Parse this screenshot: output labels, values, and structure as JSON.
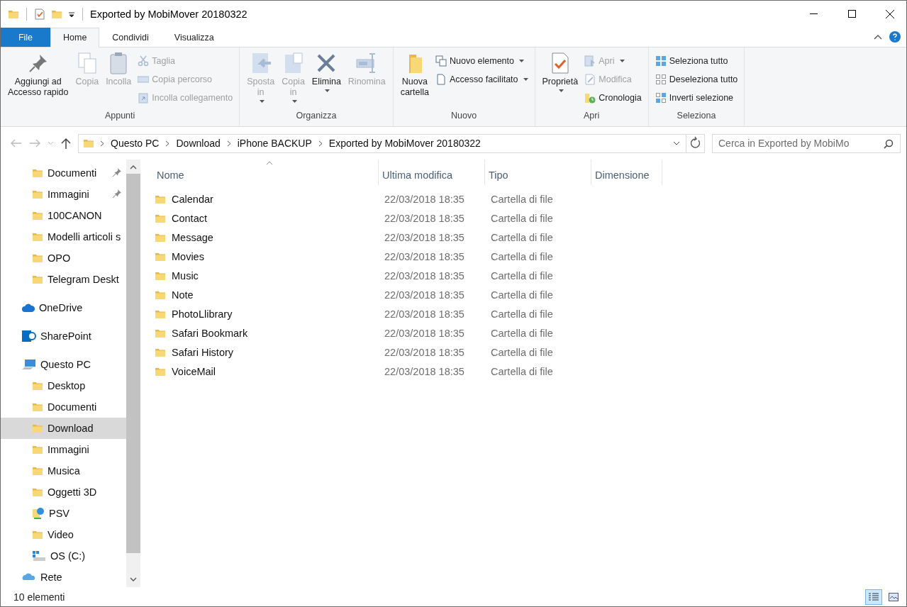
{
  "window": {
    "title": "Exported by MobiMover 20180322"
  },
  "tabs": [
    {
      "label": "File",
      "kind": "file",
      "selected": false
    },
    {
      "label": "Home",
      "kind": "tab",
      "selected": true
    },
    {
      "label": "Condividi",
      "kind": "tab",
      "selected": false
    },
    {
      "label": "Visualizza",
      "kind": "tab",
      "selected": false
    }
  ],
  "ribbon": {
    "groups": [
      {
        "label": "Appunti",
        "large": [
          {
            "label": "Aggiungi ad\nAccesso rapido",
            "disabled": false
          },
          {
            "label": "Copia",
            "disabled": true
          },
          {
            "label": "Incolla",
            "disabled": true
          }
        ],
        "small": [
          {
            "label": "Taglia",
            "disabled": true
          },
          {
            "label": "Copia percorso",
            "disabled": true
          },
          {
            "label": "Incolla collegamento",
            "disabled": true
          }
        ]
      },
      {
        "label": "Organizza",
        "large": [
          {
            "label": "Sposta\nin",
            "disabled": true,
            "dropdown": true
          },
          {
            "label": "Copia\nin",
            "disabled": true,
            "dropdown": true
          },
          {
            "label": "Elimina",
            "disabled": false,
            "dropdown": true
          },
          {
            "label": "Rinomina",
            "disabled": true,
            "dropdown": false
          }
        ]
      },
      {
        "label": "Nuovo",
        "large": [
          {
            "label": "Nuova\ncartella",
            "disabled": false
          }
        ],
        "small": [
          {
            "label": "Nuovo elemento",
            "disabled": false,
            "dropdown": true
          },
          {
            "label": "Accesso facilitato",
            "disabled": false,
            "dropdown": true
          }
        ]
      },
      {
        "label": "Apri",
        "large": [
          {
            "label": "Proprietà",
            "disabled": false,
            "dropdown": true
          }
        ],
        "small": [
          {
            "label": "Apri",
            "disabled": true,
            "dropdown": true
          },
          {
            "label": "Modifica",
            "disabled": true,
            "dropdown": false
          },
          {
            "label": "Cronologia",
            "disabled": false,
            "dropdown": false
          }
        ]
      },
      {
        "label": "Seleziona",
        "small": [
          {
            "label": "Seleziona tutto",
            "disabled": false
          },
          {
            "label": "Deseleziona tutto",
            "disabled": false
          },
          {
            "label": "Inverti selezione",
            "disabled": false
          }
        ]
      }
    ]
  },
  "address": {
    "crumbs": [
      "Questo PC",
      "Download",
      "iPhone BACKUP",
      "Exported by MobiMover 20180322"
    ]
  },
  "search": {
    "placeholder": "Cerca in Exported by MobiMo"
  },
  "sidebar": {
    "quick_access": [
      {
        "label": "Documenti",
        "pinned": true
      },
      {
        "label": "Immagini",
        "pinned": true
      },
      {
        "label": "100CANON",
        "pinned": false
      },
      {
        "label": "Modelli articoli s",
        "pinned": false
      },
      {
        "label": "OPO",
        "pinned": false
      },
      {
        "label": "Telegram Deskt",
        "pinned": false
      }
    ],
    "items": [
      {
        "label": "OneDrive",
        "kind": "cloud",
        "selected": false
      },
      {
        "label": "SharePoint",
        "kind": "site",
        "selected": false
      },
      {
        "label": "Questo PC",
        "kind": "computer",
        "selected": false,
        "children": [
          {
            "label": "Desktop",
            "kind": "folder",
            "selected": false
          },
          {
            "label": "Documenti",
            "kind": "folder",
            "selected": false
          },
          {
            "label": "Download",
            "kind": "folder",
            "selected": true
          },
          {
            "label": "Immagini",
            "kind": "folder",
            "selected": false
          },
          {
            "label": "Musica",
            "kind": "folder",
            "selected": false
          },
          {
            "label": "Oggetti 3D",
            "kind": "folder",
            "selected": false
          },
          {
            "label": "PSV",
            "kind": "network-folder",
            "selected": false
          },
          {
            "label": "Video",
            "kind": "folder",
            "selected": false
          },
          {
            "label": "OS (C:)",
            "kind": "drive",
            "selected": false
          }
        ]
      },
      {
        "label": "Rete",
        "kind": "network",
        "selected": false
      }
    ]
  },
  "table": {
    "columns": [
      {
        "label": "Nome",
        "sorted": true
      },
      {
        "label": "Ultima modifica",
        "sorted": false
      },
      {
        "label": "Tipo",
        "sorted": false
      },
      {
        "label": "Dimensione",
        "sorted": false
      }
    ],
    "rows": [
      {
        "name": "Calendar",
        "modified": "22/03/2018 18:35",
        "type": "Cartella di file"
      },
      {
        "name": "Contact",
        "modified": "22/03/2018 18:35",
        "type": "Cartella di file"
      },
      {
        "name": "Message",
        "modified": "22/03/2018 18:35",
        "type": "Cartella di file"
      },
      {
        "name": "Movies",
        "modified": "22/03/2018 18:35",
        "type": "Cartella di file"
      },
      {
        "name": "Music",
        "modified": "22/03/2018 18:35",
        "type": "Cartella di file"
      },
      {
        "name": "Note",
        "modified": "22/03/2018 18:35",
        "type": "Cartella di file"
      },
      {
        "name": "PhotoLlibrary",
        "modified": "22/03/2018 18:35",
        "type": "Cartella di file"
      },
      {
        "name": "Safari Bookmark",
        "modified": "22/03/2018 18:35",
        "type": "Cartella di file"
      },
      {
        "name": "Safari History",
        "modified": "22/03/2018 18:35",
        "type": "Cartella di file"
      },
      {
        "name": "VoiceMail",
        "modified": "22/03/2018 18:35",
        "type": "Cartella di file"
      }
    ]
  },
  "status_bar": {
    "count": "10 elementi",
    "views": [
      {
        "kind": "details",
        "selected": true
      },
      {
        "kind": "tiles",
        "selected": false
      }
    ]
  }
}
